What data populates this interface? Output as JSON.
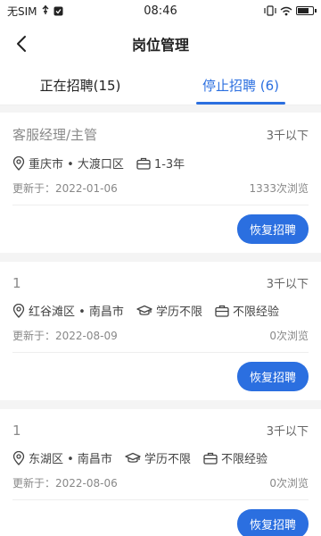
{
  "statusbar": {
    "carrier": "无SIM",
    "time": "08:46"
  },
  "navbar": {
    "title": "岗位管理"
  },
  "tabs": [
    {
      "label": "正在招聘(15)"
    },
    {
      "label": "停止招聘 (6)"
    }
  ],
  "cards": [
    {
      "title": "客服经理/主管",
      "salary": "3千以下",
      "location": "重庆市 • 大渡口区",
      "education": "",
      "experience": "1-3年",
      "updated": "更新于：2022-01-06",
      "views": "1333次浏览",
      "action": "恢复招聘"
    },
    {
      "title": "1",
      "salary": "3千以下",
      "location": "红谷滩区 • 南昌市",
      "education": "学历不限",
      "experience": "不限经验",
      "updated": "更新于：2022-08-09",
      "views": "0次浏览",
      "action": "恢复招聘"
    },
    {
      "title": "1",
      "salary": "3千以下",
      "location": "东湖区 • 南昌市",
      "education": "学历不限",
      "experience": "不限经验",
      "updated": "更新于：2022-08-06",
      "views": "0次浏览",
      "action": "恢复招聘"
    }
  ],
  "colors": {
    "accent": "#2b6fe0"
  }
}
